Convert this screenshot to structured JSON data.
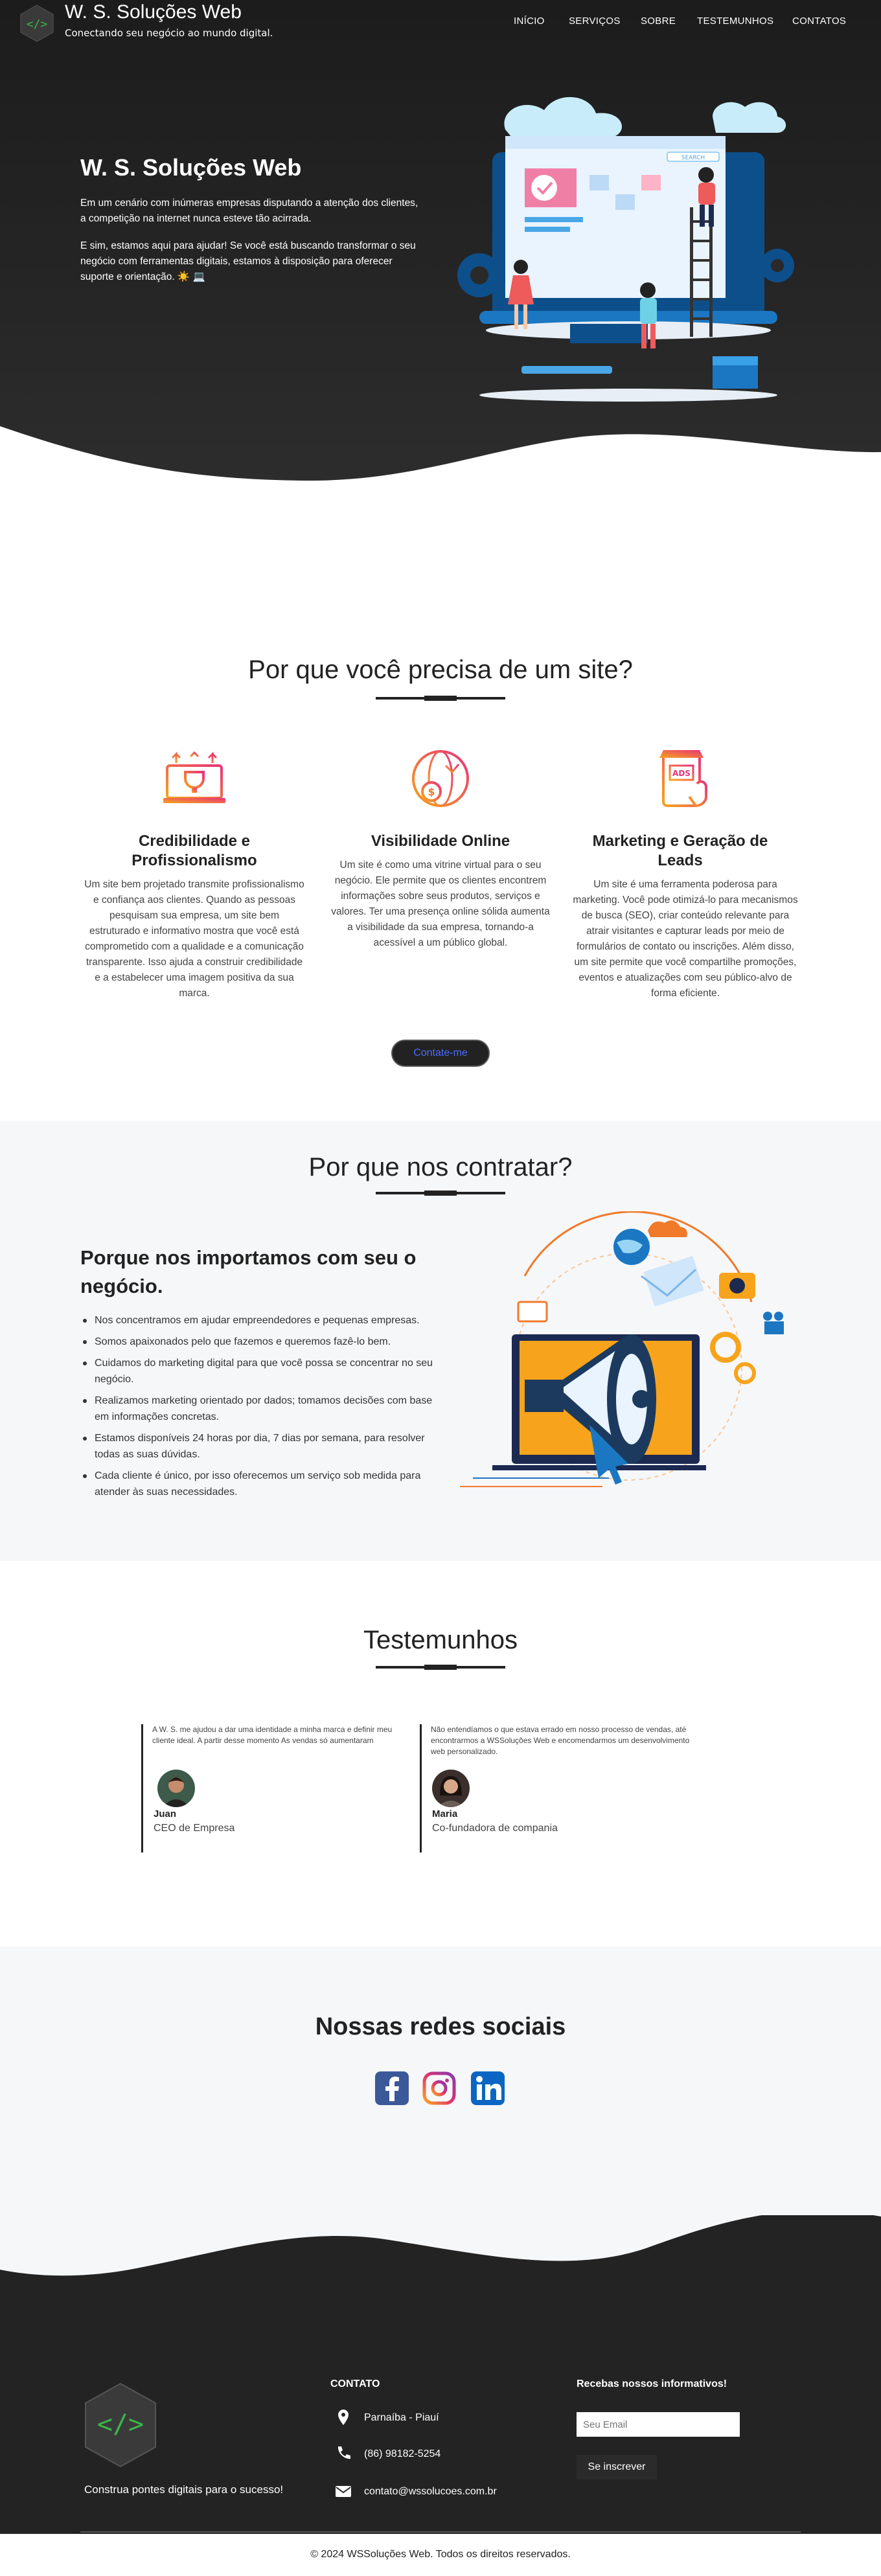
{
  "header": {
    "brand_title": "W. S. Soluções Web",
    "brand_subtitle": "Conectando seu negócio ao mundo digital.",
    "nav": [
      "INÍCIO",
      "SERVIÇOS",
      "SOBRE",
      "TESTEMUNHOS",
      "CONTATOS"
    ]
  },
  "hero": {
    "title": "W. S. Soluções Web",
    "paragraph1": "Em um cenário com inúmeras empresas disputando a atenção dos clientes, a competição na internet nunca esteve tão acirrada.",
    "paragraph2": "E sim, estamos aqui para ajudar! Se você está buscando transformar o seu negócio com ferramentas digitais, estamos à disposição para oferecer suporte e orientação. ☀️ 💻",
    "illustration_search": "SEARCH"
  },
  "why_site": {
    "title": "Por que você precisa de um site?",
    "cards": [
      {
        "title": "Credibilidade e Profissionalismo",
        "icon": "trophy-laptop-icon",
        "text": "Um site bem projetado transmite profissionalismo e confiança aos clientes. Quando as pessoas pesquisam sua empresa, um site bem estruturado e informativo mostra que você está comprometido com a qualidade e a comunicação transparente. Isso ajuda a construir credibilidade e a estabelecer uma imagem positiva da sua marca."
      },
      {
        "title": "Visibilidade Online",
        "icon": "globe-coin-icon",
        "text": "Um site é como uma vitrine virtual para o seu negócio. Ele permite que os clientes encontrem informações sobre seus produtos, serviços e valores. Ter uma presença online sólida aumenta a visibilidade da sua empresa, tornando-a acessível a um público global."
      },
      {
        "title": "Marketing e Geração de Leads",
        "icon": "ads-phone-icon",
        "text": "Um site é uma ferramenta poderosa para marketing. Você pode otimizá-lo para mecanismos de busca (SEO), criar conteúdo relevante para atrair visitantes e capturar leads por meio de formulários de contato ou inscrições. Além disso, um site permite que você compartilhe promoções, eventos e atualizações com seu público-alvo de forma eficiente."
      }
    ],
    "button_label": "Contate-me",
    "ads_label": "ADS"
  },
  "why_us": {
    "title": "Por que nos contratar?",
    "heading": "Porque nos importamos com seu o negócio.",
    "items": [
      "Nos concentramos em ajudar empreendedores e pequenas empresas.",
      "Somos apaixonados pelo que fazemos e queremos fazê-lo bem.",
      "Cuidamos do marketing digital para que você possa se concentrar no seu negócio.",
      "Realizamos marketing orientado por dados; tomamos decisões com base em informações concretas.",
      "Estamos disponíveis 24 horas por dia, 7 dias por semana, para resolver todas as suas dúvidas.",
      "Cada cliente é único, por isso oferecemos um serviço sob medida para atender às suas necessidades."
    ]
  },
  "testimonials": {
    "title": "Testemunhos",
    "items": [
      {
        "text": "A W. S. me ajudou a dar uma identidade a minha marca e definir meu cliente ideal. A partir desse momento As vendas só aumentaram",
        "name": "Juan",
        "role": "CEO de Empresa"
      },
      {
        "text": "Não entendíamos o que estava errado em nosso processo de vendas, até encontrarmos a WSSoluções Web e encomendarmos um desenvolvimento web personalizado.",
        "name": "Maria",
        "role": "Co-fundadora de compania"
      }
    ]
  },
  "social": {
    "title": "Nossas redes sociais",
    "networks": [
      "facebook-icon",
      "instagram-icon",
      "linkedin-icon"
    ],
    "colors": {
      "facebook": "#3b5998",
      "linkedin": "#0a66c2"
    }
  },
  "footer": {
    "tagline": "Construa pontes digitais para o sucesso!",
    "contact_heading": "CONTATO",
    "location": "Parnaíba - Piauí",
    "phone": "(86) 98182-5254",
    "email": "contato@wssolucoes.com.br",
    "newsletter_heading": "Recebas nossos informativos!",
    "newsletter_placeholder": "Seu Email",
    "newsletter_button": "Se inscrever",
    "copyright": "© 2024 WSSoluções Web. Todos os direitos reservados."
  },
  "colors": {
    "dark": "#232323",
    "accent_green": "#39b54a",
    "light_bg": "#f6f7f9"
  }
}
